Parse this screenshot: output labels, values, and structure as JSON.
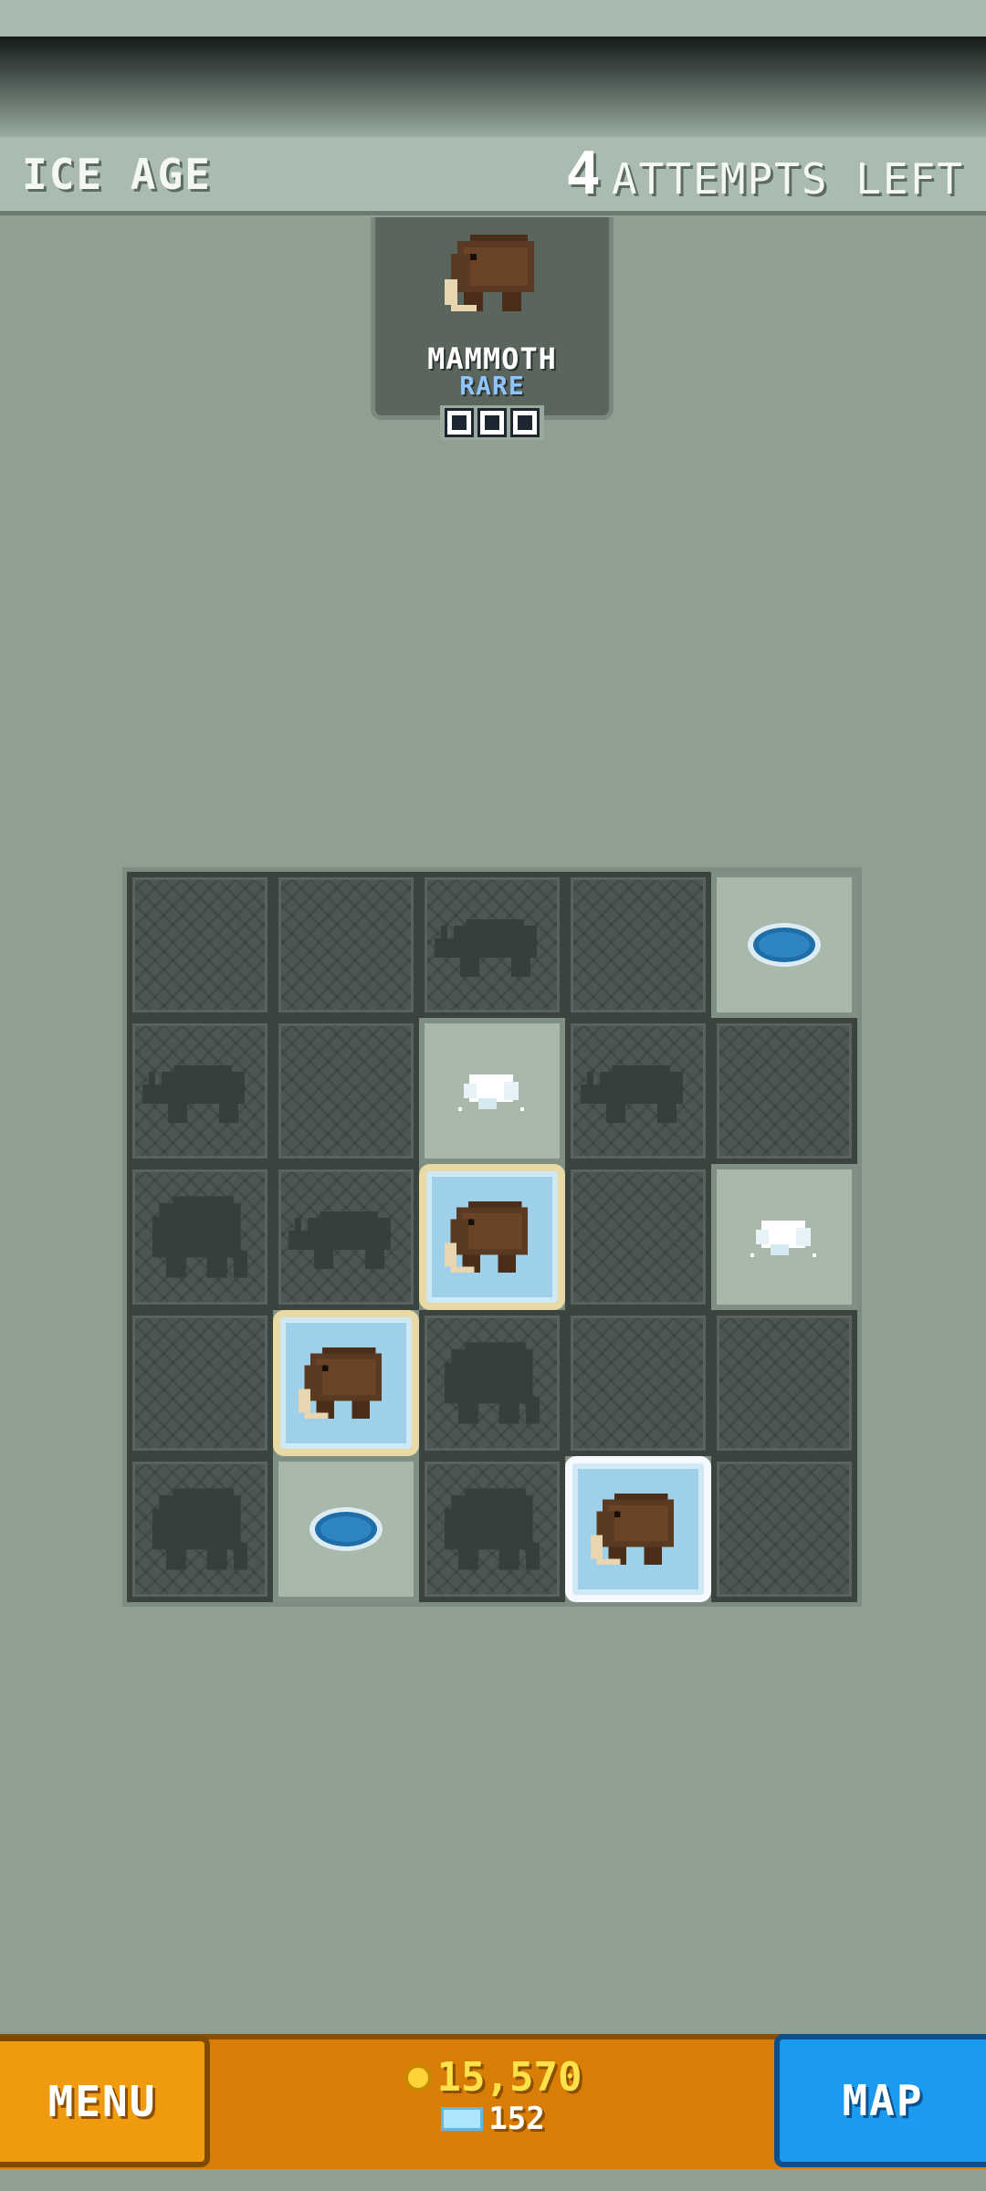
{
  "header": {
    "level_title": "ICE AGE",
    "attempts_count": "4",
    "attempts_label": "ATTEMPTS LEFT"
  },
  "target": {
    "name": "MAMMOTH",
    "rarity": "RARE",
    "progress_pips": 3,
    "icon": "mammoth-icon"
  },
  "grid": {
    "rows": [
      [
        "dug",
        "dug",
        "rhino-silhouette",
        "dug",
        "ice-puddle"
      ],
      [
        "rhino-silhouette",
        "dug",
        "ice-chunks",
        "rhino-silhouette",
        "dug"
      ],
      [
        "mammoth-silhouette",
        "rhino-silhouette",
        "mammoth-found",
        "dug",
        "ice-chunks"
      ],
      [
        "dug",
        "mammoth-found",
        "mammoth-silhouette",
        "dug",
        "dug"
      ],
      [
        "mammoth-silhouette",
        "ice-puddle",
        "mammoth-silhouette",
        "mammoth-found-selected",
        "dug"
      ]
    ]
  },
  "footer": {
    "menu_label": "MENU",
    "map_label": "MAP",
    "coins": "15,570",
    "gems": "152",
    "coin_icon": "coin-icon",
    "gem_icon": "gem-icon"
  },
  "colors": {
    "background": "#8f9f92",
    "menu": "#f09a10",
    "map": "#1a9bef",
    "footer": "#d87d06",
    "rarity": "#8fc5ff"
  }
}
